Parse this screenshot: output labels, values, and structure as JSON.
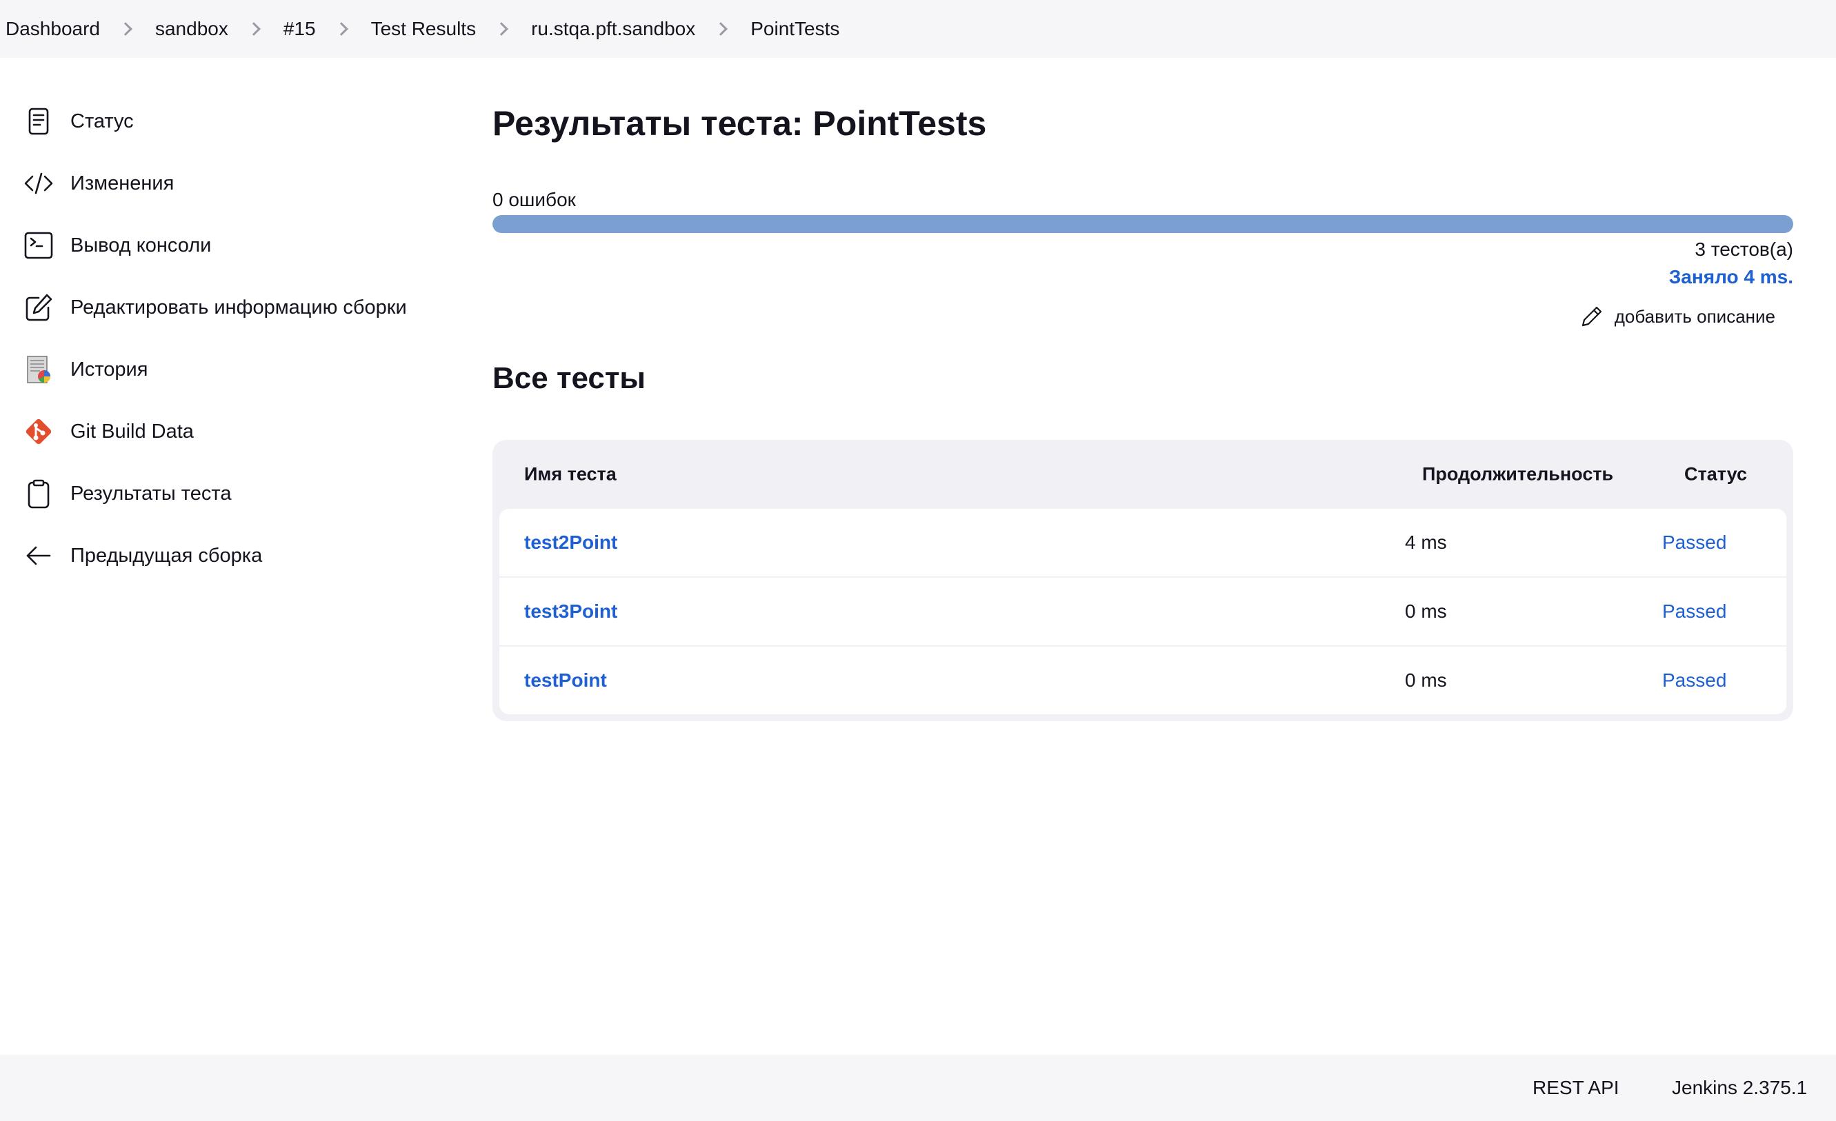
{
  "breadcrumb": [
    {
      "label": "Dashboard"
    },
    {
      "label": "sandbox"
    },
    {
      "label": "#15"
    },
    {
      "label": "Test Results"
    },
    {
      "label": "ru.stqa.pft.sandbox"
    },
    {
      "label": "PointTests"
    }
  ],
  "sidebar": {
    "items": [
      {
        "label": "Статус",
        "icon": "document-icon"
      },
      {
        "label": "Изменения",
        "icon": "code-icon"
      },
      {
        "label": "Вывод консоли",
        "icon": "terminal-icon"
      },
      {
        "label": "Редактировать информацию сборки",
        "icon": "edit-icon"
      },
      {
        "label": "История",
        "icon": "history-icon"
      },
      {
        "label": "Git Build Data",
        "icon": "git-icon"
      },
      {
        "label": "Результаты теста",
        "icon": "clipboard-icon"
      },
      {
        "label": "Предыдущая сборка",
        "icon": "arrow-left-icon"
      }
    ]
  },
  "main": {
    "title": "Результаты теста: PointTests",
    "fail_count": "0 ошибок",
    "progress_pass_fraction": 1.0,
    "test_count": "3 тестов(а)",
    "duration": "Заняло 4 ms.",
    "add_description": "добавить описание",
    "section_title": "Все тесты"
  },
  "table": {
    "headers": {
      "name": "Имя теста",
      "duration": "Продолжительность",
      "status": "Статус"
    },
    "rows": [
      {
        "name": "test2Point",
        "duration": "4 ms",
        "status": "Passed"
      },
      {
        "name": "test3Point",
        "duration": "0 ms",
        "status": "Passed"
      },
      {
        "name": "testPoint",
        "duration": "0 ms",
        "status": "Passed"
      }
    ]
  },
  "footer": {
    "rest_api": "REST API",
    "version": "Jenkins 2.375.1"
  },
  "colors": {
    "link": "#1e5fd1",
    "progress_pass": "#7b9fd1",
    "git": "#e24e2e",
    "bar_background": "#f6f6f8"
  }
}
